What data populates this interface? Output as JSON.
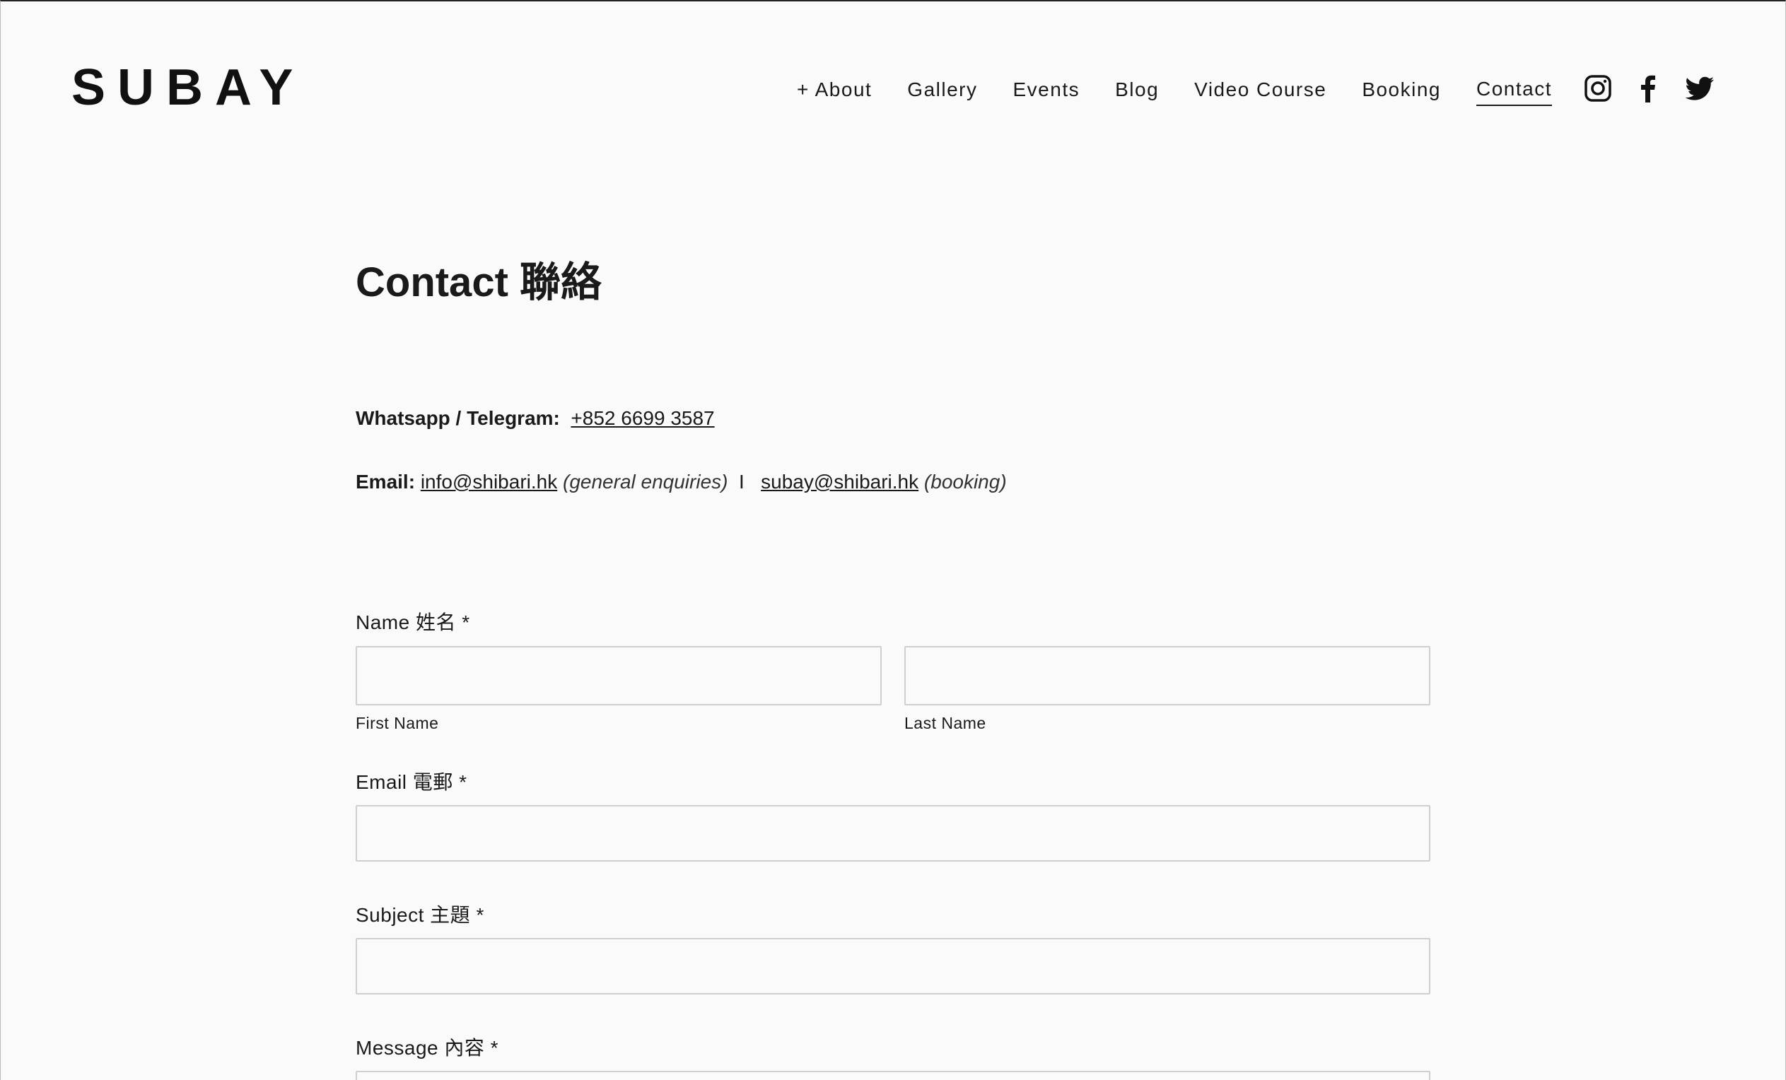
{
  "header": {
    "logo": "SUBAY",
    "nav": [
      "+ About",
      "Gallery",
      "Events",
      "Blog",
      "Video Course",
      "Booking",
      "Contact"
    ],
    "active_nav": "Contact",
    "social_icons": [
      "instagram-icon",
      "facebook-icon",
      "twitter-icon"
    ]
  },
  "main": {
    "title": "Contact 聯絡",
    "phone_label": "Whatsapp / Telegram:",
    "phone": "+852 6699 3587",
    "email_label": "Email:",
    "email_general": "info@shibari.hk",
    "email_general_note": "(general enquiries)",
    "separator": "I",
    "email_booking": "subay@shibari.hk",
    "email_booking_note": "(booking)"
  },
  "form": {
    "name_label": "Name 姓名 *",
    "first_name_label": "First Name",
    "last_name_label": "Last Name",
    "email_label": "Email 電郵 *",
    "subject_label": "Subject 主題 *",
    "message_label": "Message 內容 *"
  },
  "colors": {
    "background": "#fafafa",
    "text": "#1a1a1a",
    "input_border": "#cfcfcf"
  }
}
